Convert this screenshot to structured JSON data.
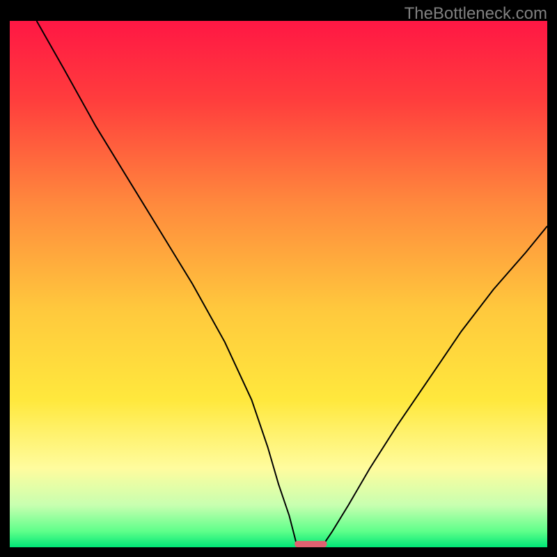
{
  "watermark": "TheBottleneck.com",
  "chart_data": {
    "type": "line",
    "title": "",
    "xlabel": "",
    "ylabel": "",
    "xlim": [
      0,
      100
    ],
    "ylim": [
      0,
      100
    ],
    "background_gradient": {
      "stops": [
        {
          "offset": 0.0,
          "color": "#ff1744"
        },
        {
          "offset": 0.15,
          "color": "#ff3d3d"
        },
        {
          "offset": 0.35,
          "color": "#ff8a3d"
        },
        {
          "offset": 0.55,
          "color": "#ffc93d"
        },
        {
          "offset": 0.72,
          "color": "#ffe83d"
        },
        {
          "offset": 0.85,
          "color": "#fffc9e"
        },
        {
          "offset": 0.92,
          "color": "#c8ffb0"
        },
        {
          "offset": 0.97,
          "color": "#5eff8a"
        },
        {
          "offset": 1.0,
          "color": "#00e676"
        }
      ]
    },
    "series": [
      {
        "name": "left-curve",
        "type": "line",
        "color": "#000000",
        "width": 2,
        "x": [
          5,
          10,
          16,
          22,
          28,
          34,
          40,
          45,
          48,
          50,
          52,
          53,
          53.5
        ],
        "y": [
          100,
          91,
          80,
          70,
          60,
          50,
          39,
          28,
          19,
          12,
          6,
          2,
          0
        ]
      },
      {
        "name": "right-curve",
        "type": "line",
        "color": "#000000",
        "width": 2,
        "x": [
          58,
          60,
          63,
          67,
          72,
          78,
          84,
          90,
          96,
          100
        ],
        "y": [
          0,
          3,
          8,
          15,
          23,
          32,
          41,
          49,
          56,
          61
        ]
      },
      {
        "name": "bottom-marker",
        "type": "bar",
        "color": "#e06070",
        "x_start": 53,
        "x_end": 59,
        "y": 0,
        "height": 1.2
      }
    ]
  }
}
